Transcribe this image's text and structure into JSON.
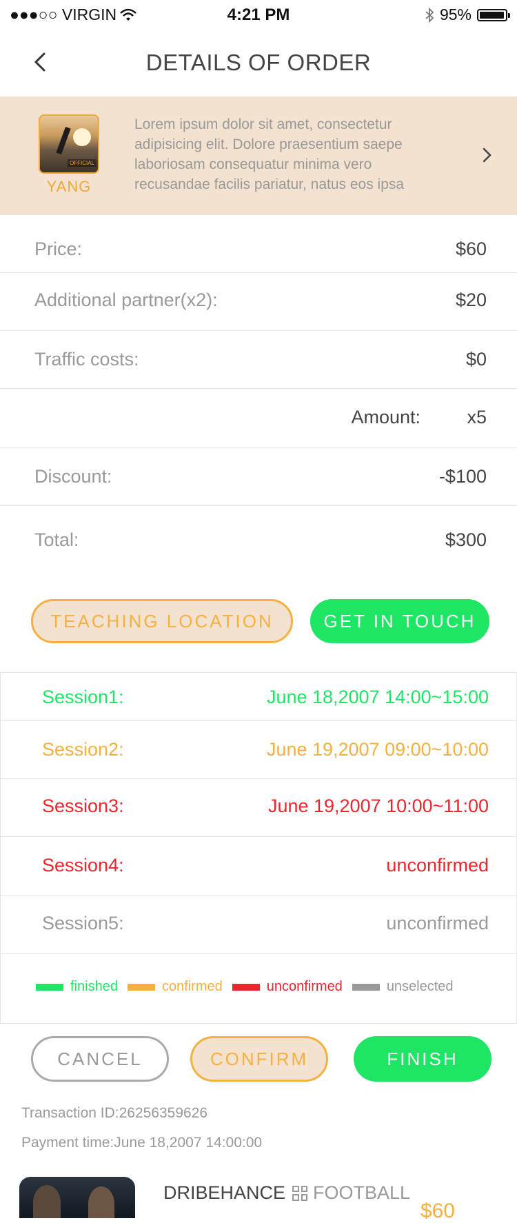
{
  "status_bar": {
    "carrier": "●●●○○ VIRGIN",
    "time": "4:21 PM",
    "battery": "95%"
  },
  "nav": {
    "title": "DETAILS OF ORDER"
  },
  "banner": {
    "name": "YANG",
    "thumb_tag": "OFFICIAL",
    "description": "Lorem ipsum dolor sit amet, consectetur adipisicing elit. Dolore praesentium saepe laboriosam consequatur minima vero recusandae facilis pariatur, natus eos ipsa"
  },
  "pricing": {
    "price_label": "Price:",
    "price_value": "$60",
    "partner_label": "Additional partner(x2):",
    "partner_value": "$20",
    "traffic_label": "Traffic costs:",
    "traffic_value": "$0",
    "amount_label": "Amount:",
    "amount_value": "x5",
    "discount_label": "Discount:",
    "discount_value": "-$100",
    "total_label": "Total:",
    "total_value": "$300"
  },
  "actions": {
    "teaching_location": "TEACHING LOCATION",
    "get_in_touch": "GET IN TOUCH"
  },
  "sessions": [
    {
      "label": "Session1:",
      "value": "June 18,2007 14:00~15:00",
      "color": "#1ee564"
    },
    {
      "label": "Session2:",
      "value": "June 19,2007 09:00~10:00",
      "color": "#f5b040"
    },
    {
      "label": "Session3:",
      "value": "June 19,2007 10:00~11:00",
      "color": "#e8262d"
    },
    {
      "label": "Session4:",
      "value": "unconfirmed",
      "color": "#e8262d"
    },
    {
      "label": "Session5:",
      "value": "unconfirmed",
      "color": "#999999"
    }
  ],
  "legend": [
    {
      "label": "finished",
      "color": "#1ee564"
    },
    {
      "label": "confirmed",
      "color": "#f5b040"
    },
    {
      "label": "unconfirmed",
      "color": "#e8262d"
    },
    {
      "label": "unselected",
      "color": "#999999"
    }
  ],
  "footer_buttons": {
    "cancel": "CANCEL",
    "confirm": "CONFIRM",
    "finish": "FINISH"
  },
  "transaction": {
    "id": "Transaction ID:26256359626",
    "payment_time": "Payment time:June 18,2007 14:00:00"
  },
  "bottom_card": {
    "title": "DRIBEHANCE",
    "category": "FOOTBALL",
    "price": "$60"
  }
}
